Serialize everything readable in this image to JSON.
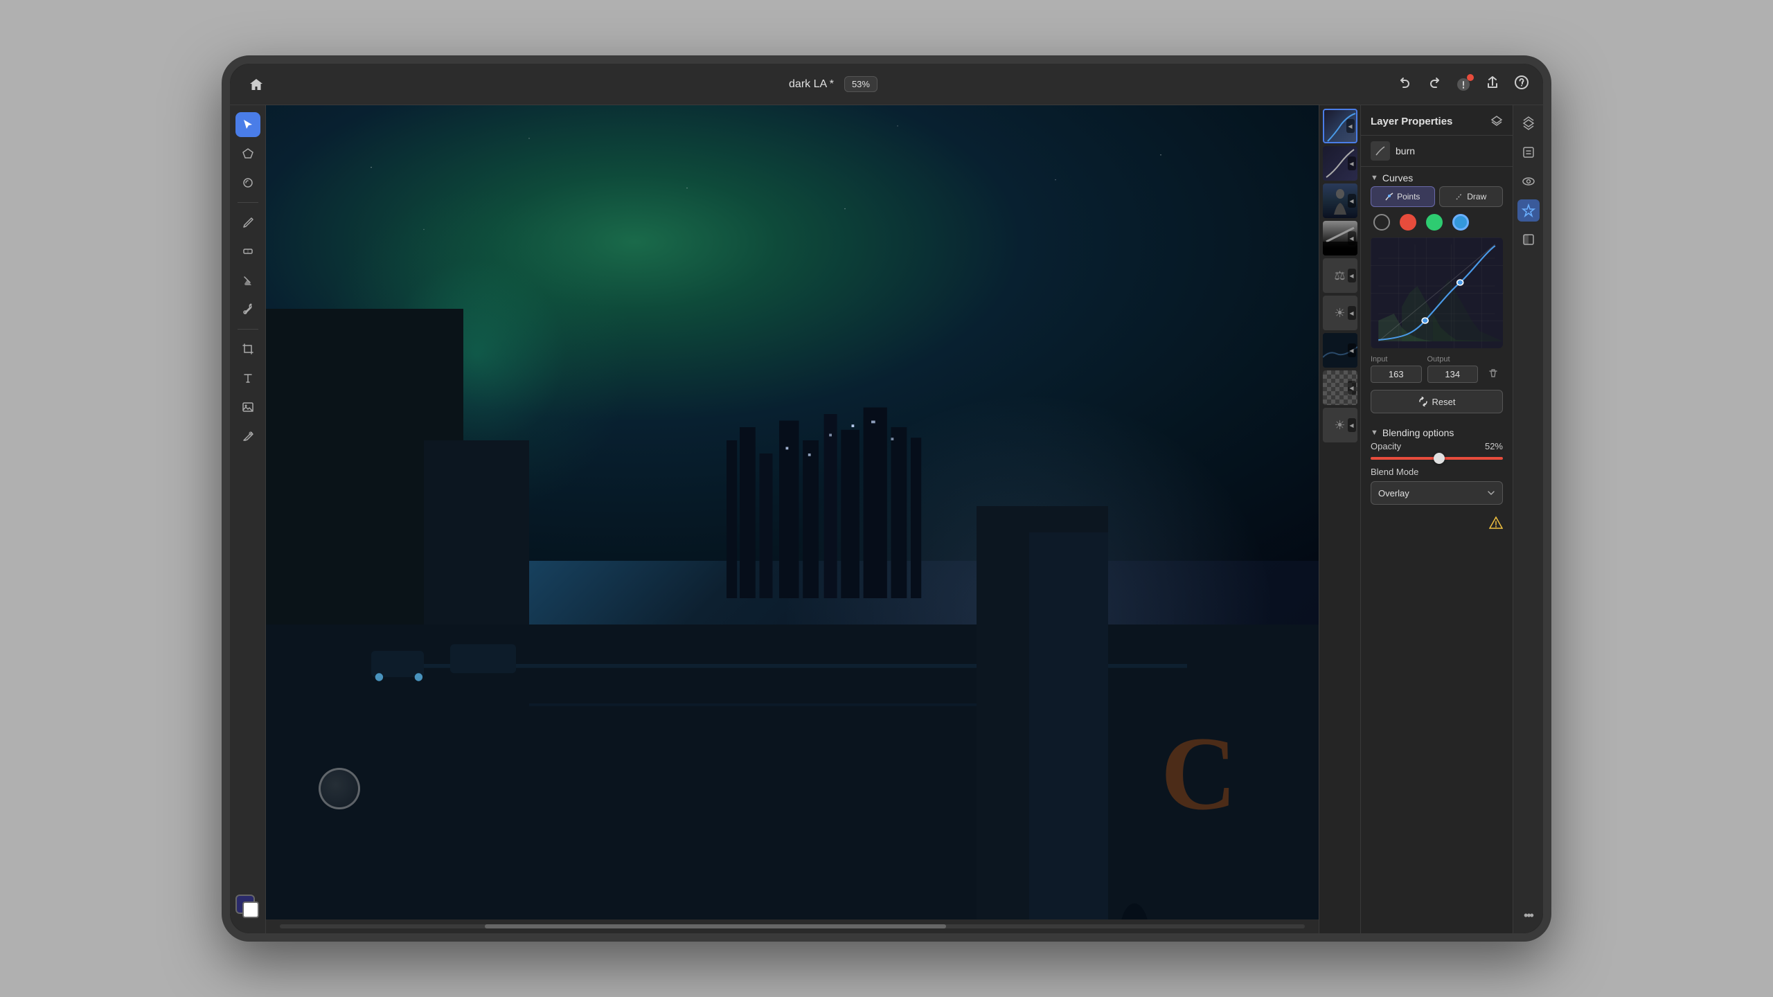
{
  "app": {
    "title": "dark LA *",
    "zoom": "53%"
  },
  "topbar": {
    "home_label": "⌂",
    "undo_label": "↩",
    "redo_label": "↪",
    "share_label": "⬆",
    "help_label": "?"
  },
  "left_tools": [
    {
      "id": "select",
      "icon": "▶",
      "active": true
    },
    {
      "id": "lasso",
      "icon": "⬡",
      "active": false
    },
    {
      "id": "magic",
      "icon": "✦",
      "active": false
    },
    {
      "id": "brush",
      "icon": "✏",
      "active": false
    },
    {
      "id": "eraser",
      "icon": "⬜",
      "active": false
    },
    {
      "id": "fill",
      "icon": "⬧",
      "active": false
    },
    {
      "id": "colorpicker",
      "icon": "⬯",
      "active": false
    },
    {
      "id": "crop",
      "icon": "⬚",
      "active": false
    },
    {
      "id": "text",
      "icon": "T",
      "active": false
    },
    {
      "id": "image",
      "icon": "🖼",
      "active": false
    },
    {
      "id": "sample",
      "icon": "⬭",
      "active": false
    }
  ],
  "layers": [
    {
      "id": "l1",
      "type": "curves",
      "active": true
    },
    {
      "id": "l2",
      "type": "curves2"
    },
    {
      "id": "l3",
      "type": "person"
    },
    {
      "id": "l4",
      "type": "black"
    },
    {
      "id": "l5",
      "type": "balance",
      "icon": "⚖"
    },
    {
      "id": "l6",
      "type": "brightness",
      "icon": "☀"
    },
    {
      "id": "l7",
      "type": "scene"
    },
    {
      "id": "l8",
      "type": "checker"
    },
    {
      "id": "l9",
      "type": "sun",
      "icon": "☀"
    }
  ],
  "right_panel": {
    "title": "Layer Properties",
    "layer_name": "burn",
    "curves_section": "Curves",
    "points_label": "Points",
    "draw_label": "Draw",
    "channels": [
      "rgb",
      "red",
      "green",
      "blue"
    ],
    "active_channel": "blue",
    "input_label": "Input",
    "output_label": "Output",
    "input_value": "163",
    "output_value": "134",
    "reset_label": "Reset",
    "blending_title": "Blending options",
    "opacity_label": "Opacity",
    "opacity_value": "52%",
    "blend_mode_label": "Blend Mode",
    "blend_mode_value": "Overlay"
  },
  "right_icons": [
    {
      "id": "layers",
      "icon": "≡",
      "active": false
    },
    {
      "id": "layer-props",
      "icon": "≋",
      "active": false
    },
    {
      "id": "visibility",
      "icon": "◉",
      "active": false
    },
    {
      "id": "fx",
      "icon": "★",
      "active": true
    },
    {
      "id": "mask",
      "icon": "◨",
      "active": false
    },
    {
      "id": "more",
      "icon": "•••",
      "active": false
    }
  ],
  "colors": {
    "accent": "#4a7de8",
    "red_channel": "#e74c3c",
    "green_channel": "#2ecc71",
    "blue_channel": "#3498db",
    "panel_bg": "#252525",
    "topbar_bg": "#2c2c2c"
  }
}
